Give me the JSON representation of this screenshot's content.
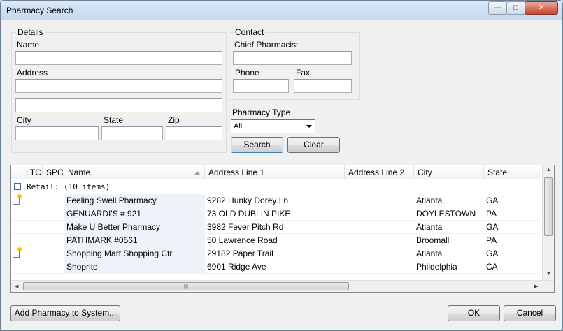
{
  "window": {
    "title": "Pharmacy Search",
    "controls": {
      "minimize": "—",
      "maximize": "□",
      "close": "✕"
    }
  },
  "details": {
    "group_label": "Details",
    "name_label": "Name",
    "name_value": "",
    "address_label": "Address",
    "address1_value": "",
    "address2_value": "",
    "city_label": "City",
    "city_value": "",
    "state_label": "State",
    "state_value": "",
    "zip_label": "Zip",
    "zip_value": ""
  },
  "contact": {
    "group_label": "Contact",
    "chief_label": "Chief Pharmacist",
    "chief_value": "",
    "phone_label": "Phone",
    "phone_value": "",
    "fax_label": "Fax",
    "fax_value": ""
  },
  "pharmacy_type": {
    "label": "Pharmacy Type",
    "selected": "All"
  },
  "buttons": {
    "search": "Search",
    "clear": "Clear",
    "add": "Add Pharmacy to System...",
    "ok": "OK",
    "cancel": "Cancel"
  },
  "grid": {
    "columns": [
      "LTC",
      "SPC",
      "Name",
      "Address Line 1",
      "Address Line 2",
      "City",
      "State"
    ],
    "sort_column": "Name",
    "group_label": "Retail: (10 items)",
    "rows": [
      {
        "note": true,
        "name": "Feeling Swell Pharmacy",
        "address1": "9282 Hunky Dorey Ln",
        "address2": "",
        "city": "Atlanta",
        "state": "GA"
      },
      {
        "note": false,
        "name": "GENUARDI'S # 921",
        "address1": "73 OLD DUBLIN PIKE",
        "address2": "",
        "city": "DOYLESTOWN",
        "state": "PA"
      },
      {
        "note": false,
        "name": "Make U Better Pharmacy",
        "address1": "3982 Fever Pitch Rd",
        "address2": "",
        "city": "Atlanta",
        "state": "GA"
      },
      {
        "note": false,
        "name": "PATHMARK #0561",
        "address1": "50 Lawrence Road",
        "address2": "",
        "city": "Broomall",
        "state": "PA"
      },
      {
        "note": true,
        "name": "Shopping Mart Shopping Ctr",
        "address1": "29182 Paper Trail",
        "address2": "",
        "city": "Atlanta",
        "state": "GA"
      },
      {
        "note": false,
        "name": "Shoprite",
        "address1": "6901 Ridge Ave",
        "address2": "",
        "city": "Phildelphia",
        "state": "CA"
      }
    ]
  },
  "icons": {
    "note": "note-icon",
    "expander": "collapse-icon"
  }
}
